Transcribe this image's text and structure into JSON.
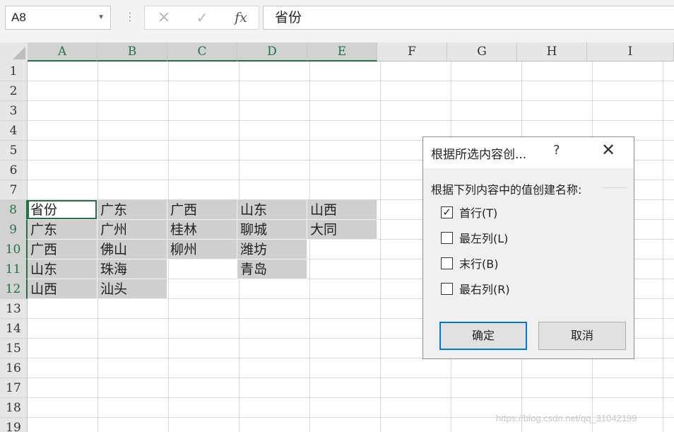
{
  "formula_bar": {
    "name_box": "A8",
    "cancel_icon": "×",
    "enter_icon": "✓",
    "fx_label": "fx",
    "formula_value": "省份"
  },
  "columns": [
    "A",
    "B",
    "C",
    "D",
    "E",
    "F",
    "G",
    "H",
    "I"
  ],
  "rows": [
    "1",
    "2",
    "3",
    "4",
    "5",
    "6",
    "7",
    "8",
    "9",
    "10",
    "11",
    "12",
    "13",
    "14",
    "15",
    "16",
    "17",
    "18",
    "19"
  ],
  "selected_columns": [
    "A",
    "B",
    "C",
    "D",
    "E"
  ],
  "selected_rows": [
    "8",
    "9",
    "10",
    "11",
    "12"
  ],
  "cells": {
    "A8": "省份",
    "A9": "广东",
    "A10": "广西",
    "A11": "山东",
    "A12": "山西",
    "B8": "广东",
    "B9": "广州",
    "B10": "佛山",
    "B11": "珠海",
    "B12": "汕头",
    "C8": "广西",
    "C9": "桂林",
    "C10": "柳州",
    "D8": "山东",
    "D9": "聊城",
    "D10": "潍坊",
    "D11": "青岛",
    "E8": "山西",
    "E9": "大同"
  },
  "dialog": {
    "title": "根据所选内容创...",
    "help": "?",
    "close": "✕",
    "prompt": "根据下列内容中的值创建名称:",
    "options": [
      {
        "label": "首行(T)",
        "checked": true
      },
      {
        "label": "最左列(L)",
        "checked": false
      },
      {
        "label": "末行(B)",
        "checked": false
      },
      {
        "label": "最右列(R)",
        "checked": false
      }
    ],
    "ok": "确定",
    "cancel": "取消"
  },
  "colors": {
    "excel_green": "#217346",
    "annotation_red": "#e23b3b",
    "selection_gray": "#cfcfcf"
  },
  "watermark": "https://blog.csdn.net/qq_31042199"
}
